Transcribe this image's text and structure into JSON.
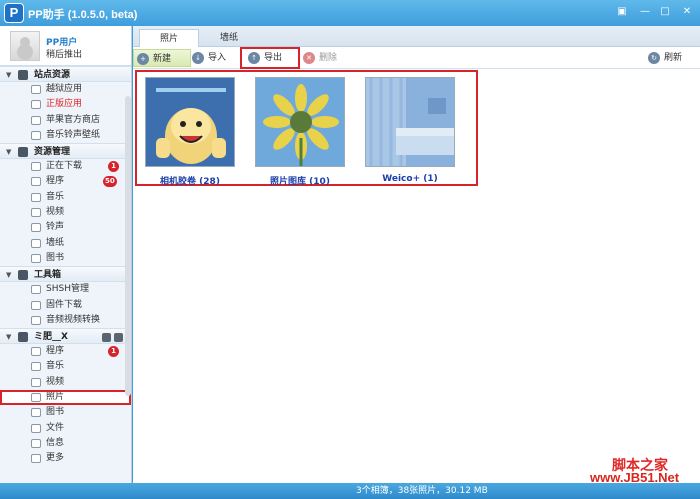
{
  "app": {
    "logo": "P",
    "title": "PP助手 (1.0.5.0, beta)"
  },
  "user": {
    "name": "PP用户",
    "logout": "稍后推出"
  },
  "sidebar": {
    "groups": [
      {
        "title": "站点资源",
        "items": [
          "越狱应用",
          "正版应用",
          "苹果官方商店",
          "音乐铃声壁纸"
        ]
      },
      {
        "title": "资源管理",
        "items": [
          "正在下载",
          "程序",
          "音乐",
          "视频",
          "铃声",
          "墙纸",
          "图书"
        ],
        "badges": {
          "download": "1",
          "apps": "50"
        }
      },
      {
        "title": "工具箱",
        "items": [
          "SHSH管理",
          "固件下载",
          "音频视频转换"
        ]
      },
      {
        "title": "ミ肥__X",
        "items": [
          "程序",
          "音乐",
          "视频",
          "照片",
          "图书",
          "文件",
          "信息",
          "更多"
        ],
        "badges": {
          "apps": "1"
        }
      }
    ]
  },
  "tabs": [
    "照片",
    "墙纸"
  ],
  "toolbar": {
    "new": "新建",
    "import": "导入",
    "export": "导出",
    "delete": "删除",
    "refresh": "刷新"
  },
  "albums": [
    {
      "label": "相机胶卷 (28)"
    },
    {
      "label": "照片图库 (10)"
    },
    {
      "label": "Weico+ (1)"
    }
  ],
  "status": "3个相簿，38张照片，30.12 MB",
  "watermark": {
    "line1": "脚本之家",
    "line2": "www.JB51.Net"
  }
}
